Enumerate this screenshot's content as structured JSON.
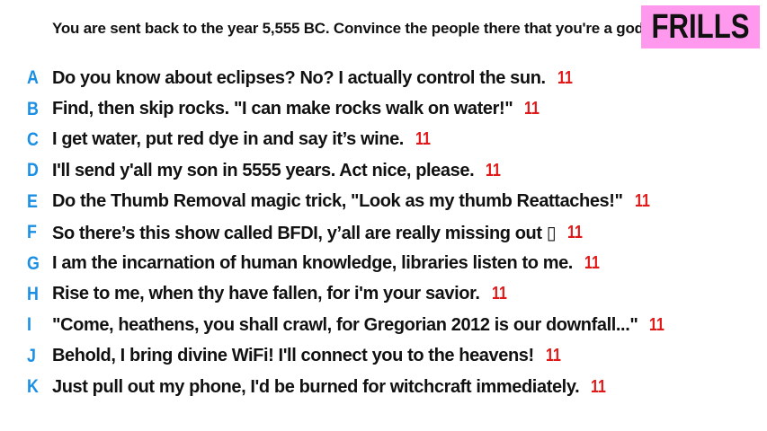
{
  "prompt": "You are sent back to the year 5,555 BC. Convince the people there that you're a god.",
  "badge": {
    "label": "FRILLS",
    "background": "#ff99ee",
    "text_color": "#111111"
  },
  "colors": {
    "letter": "#1a8fe3",
    "score": "#e01818"
  },
  "answers": [
    {
      "letter": "A",
      "text": "Do you know about eclipses? No? I actually control the sun.",
      "score": "11"
    },
    {
      "letter": "B",
      "text": "Find, then skip rocks. \"I can make rocks walk on water!\"",
      "score": "11"
    },
    {
      "letter": "C",
      "text": "I get water, put red dye in and say it’s wine.",
      "score": "11"
    },
    {
      "letter": "D",
      "text": "I'll send y'all my son in 5555 years. Act nice, please.",
      "score": "11"
    },
    {
      "letter": "E",
      "text": "Do the Thumb Removal magic trick, \"Look as my thumb Reattaches!\"",
      "score": "11"
    },
    {
      "letter": "F",
      "text": "So there’s this show called BFDI, y’all are really missing out ▯",
      "score": "11"
    },
    {
      "letter": "G",
      "text": "I am the incarnation of human knowledge, libraries listen to me.",
      "score": "11"
    },
    {
      "letter": "H",
      "text": "Rise to me, when thy have fallen, for i'm your savior.",
      "score": "11"
    },
    {
      "letter": "I",
      "text": "\"Come, heathens, you shall crawl, for Gregorian 2012 is our downfall...\"",
      "score": "11"
    },
    {
      "letter": "J",
      "text": "Behold, I bring divine WiFi! I'll connect you to the heavens!",
      "score": "11"
    },
    {
      "letter": "K",
      "text": "Just pull out my phone, I'd be burned for witchcraft immediately.",
      "score": "11"
    }
  ]
}
